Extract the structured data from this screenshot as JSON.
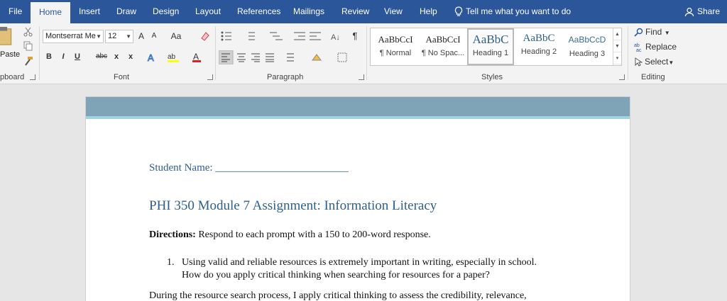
{
  "tabs": [
    {
      "label": "File",
      "active": false
    },
    {
      "label": "Home",
      "active": true
    },
    {
      "label": "Insert",
      "active": false
    },
    {
      "label": "Draw",
      "active": false
    },
    {
      "label": "Design",
      "active": false
    },
    {
      "label": "Layout",
      "active": false
    },
    {
      "label": "References",
      "active": false
    },
    {
      "label": "Mailings",
      "active": false
    },
    {
      "label": "Review",
      "active": false
    },
    {
      "label": "View",
      "active": false
    },
    {
      "label": "Help",
      "active": false
    }
  ],
  "tell_me": "Tell me what you want to do",
  "share": "Share",
  "ribbon": {
    "clipboard": {
      "paste_label": "Paste",
      "group_label": "pboard"
    },
    "font": {
      "font_name": "Montserrat Me",
      "font_size": "12",
      "group_label": "Font",
      "grow_label": "A",
      "shrink_label": "A",
      "case_label": "Aa",
      "bold_label": "B",
      "italic_label": "I",
      "underline_label": "U",
      "strike_label": "abc",
      "sub_label": "x",
      "sup_label": "x"
    },
    "paragraph": {
      "group_label": "Paragraph",
      "pilcrow": "¶"
    },
    "styles": {
      "group_label": "Styles",
      "items": [
        {
          "sample": "AaBbCcI",
          "name": "¶ Normal"
        },
        {
          "sample": "AaBbCcI",
          "name": "¶ No Spac..."
        },
        {
          "sample": "AaBbC",
          "name": "Heading 1"
        },
        {
          "sample": "AaBbC",
          "name": "Heading 2"
        },
        {
          "sample": "AaBbCcD",
          "name": "Heading 3"
        }
      ]
    },
    "editing": {
      "group_label": "Editing",
      "find_label": "Find",
      "replace_label": "Replace",
      "select_label": "Select"
    }
  },
  "document": {
    "student_name": "Student Name: _________________________",
    "title": "PHI 350 Module 7 Assignment: Information Literacy",
    "directions_bold": "Directions:",
    "directions_text": " Respond to each prompt with a 150 to 200-word response.",
    "list_number": "1.",
    "list_line1": "Using valid and reliable resources is extremely important in writing, especially in school.",
    "list_line2": "How do you apply critical thinking when searching for resources for a paper?",
    "paragraph_line1": "During the resource search process, I apply critical thinking to assess the credibility, relevance,"
  },
  "colors": {
    "tab_bar": "#2b579a",
    "ribbon_bg": "#f3f3f3",
    "heading_blue": "#2e5f8a",
    "header_band": "#7fa4b8",
    "header_line": "#9fd3de"
  }
}
